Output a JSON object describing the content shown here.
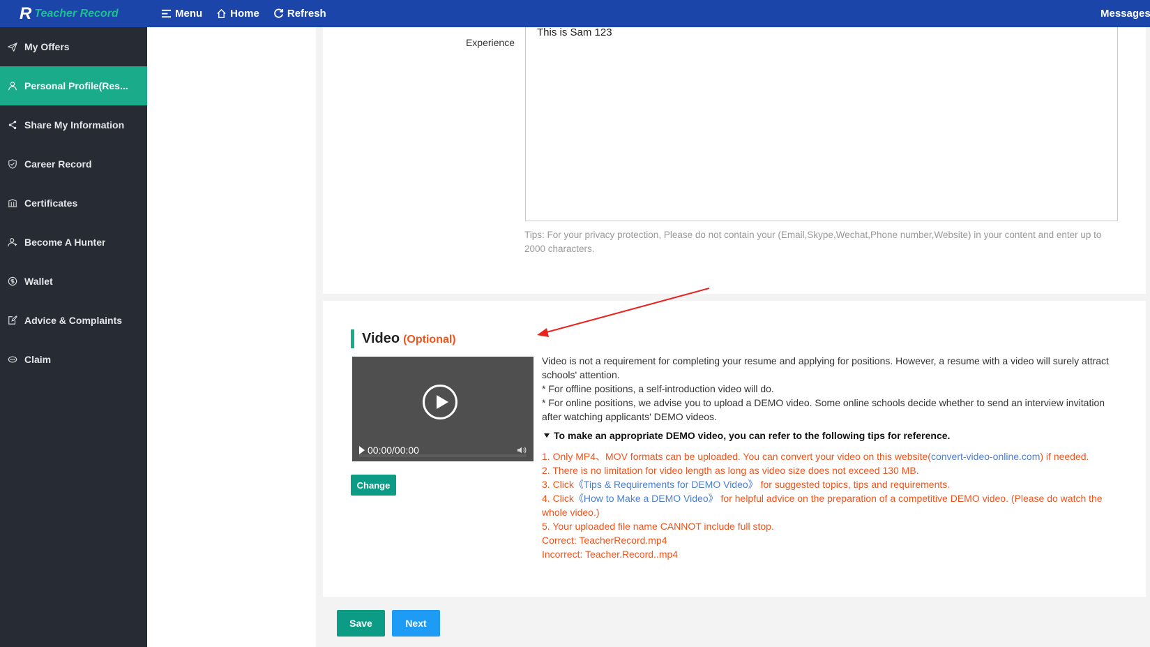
{
  "topbar": {
    "logo_mark": "R",
    "logo_text": "Teacher Record",
    "menu_label": "Menu",
    "home_label": "Home",
    "refresh_label": "Refresh",
    "messages_label": "Messages"
  },
  "sidebar": {
    "items": [
      {
        "label": "My Offers",
        "icon": "paper-plane-icon"
      },
      {
        "label": "Personal Profile(Res...",
        "icon": "person-icon"
      },
      {
        "label": "Share My Information",
        "icon": "share-icon"
      },
      {
        "label": "Career Record",
        "icon": "shield-icon"
      },
      {
        "label": "Certificates",
        "icon": "certificate-icon"
      },
      {
        "label": "Become A Hunter",
        "icon": "person-hunter-icon"
      },
      {
        "label": "Wallet",
        "icon": "dollar-icon"
      },
      {
        "label": "Advice & Complaints",
        "icon": "edit-doc-icon"
      },
      {
        "label": "Claim",
        "icon": "claim-icon"
      }
    ],
    "active_index": 1
  },
  "experience": {
    "label": "Experience",
    "value": "This is Sam 123",
    "tips": "Tips: For your privacy protection, Please do not contain your (Email,Skype,Wechat,Phone number,Website) in your content and enter up to 2000 characters."
  },
  "video": {
    "title": "Video",
    "optional": "(Optional)",
    "player_time": "00:00/00:00",
    "change_label": "Change",
    "desc": [
      "Video is not a requirement for completing your resume and applying for positions. However, a resume with a video will surely attract schools' attention.",
      "* For offline positions, a self-introduction video will do.",
      "* For online positions, we advise you to upload a DEMO video. Some online schools decide whether to send an interview invitation after watching applicants' DEMO videos."
    ],
    "tips_head": "To make an appropriate DEMO video, you can refer to the following tips for reference.",
    "tip1_a": "1. Only MP4、MOV formats can be uploaded. You can convert your video on this website(",
    "tip1_link": "convert-video-online.com",
    "tip1_b": ") if needed.",
    "tip2": "2. There is no limitation for video length as long as video size does not exceed 130 MB.",
    "tip3_a": "3. Click",
    "tip3_link": "《Tips & Requirements for DEMO Video》",
    "tip3_b": "for suggested topics, tips and requirements.",
    "tip4_a": "4. Click",
    "tip4_link": "《How to Make a DEMO Video》",
    "tip4_b": " for helpful advice on the preparation of a competitive DEMO video. (Please do watch the whole video.)",
    "tip5": "5. Your uploaded file name CANNOT include full stop.",
    "tip6": "Correct: TeacherRecord.mp4",
    "tip7": "Incorrect: Teacher.Record..mp4"
  },
  "actions": {
    "save_label": "Save",
    "next_label": "Next"
  },
  "colors": {
    "topbar": "#1b45a8",
    "sidebar": "#262b34",
    "accent_green": "#1aab8a",
    "button_blue": "#1e9bf5",
    "warning_orange": "#f2541b",
    "annotation_arrow": "#e8231d"
  }
}
